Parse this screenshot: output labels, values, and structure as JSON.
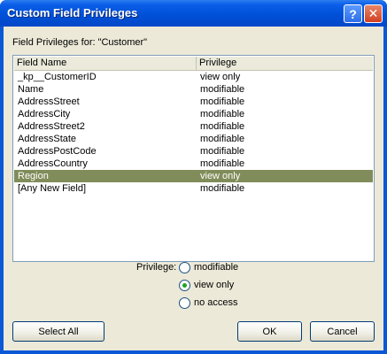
{
  "window": {
    "title": "Custom Field Privileges",
    "help_glyph": "?",
    "close_glyph": "✕"
  },
  "header": {
    "label": "Field Privileges for: \"Customer\""
  },
  "table": {
    "columns": [
      "Field Name",
      "Privilege"
    ],
    "rows": [
      {
        "field": "_kp__CustomerID",
        "privilege": "view only"
      },
      {
        "field": "Name",
        "privilege": "modifiable"
      },
      {
        "field": "AddressStreet",
        "privilege": "modifiable"
      },
      {
        "field": "AddressCity",
        "privilege": "modifiable"
      },
      {
        "field": "AddressStreet2",
        "privilege": "modifiable"
      },
      {
        "field": "AddressState",
        "privilege": "modifiable"
      },
      {
        "field": "AddressPostCode",
        "privilege": "modifiable"
      },
      {
        "field": "AddressCountry",
        "privilege": "modifiable"
      },
      {
        "field": "Region",
        "privilege": "view only"
      },
      {
        "field": "[Any New Field]",
        "privilege": "modifiable"
      }
    ],
    "selected_row": 8
  },
  "privilege": {
    "label": "Privilege:",
    "options": [
      "modifiable",
      "view only",
      "no access"
    ],
    "selected": "view only"
  },
  "buttons": {
    "select_all": "Select All",
    "ok": "OK",
    "cancel": "Cancel"
  },
  "colors": {
    "title_bar": "#0050d8",
    "selection": "#808c5a",
    "dialog_bg": "#ece9d8"
  }
}
